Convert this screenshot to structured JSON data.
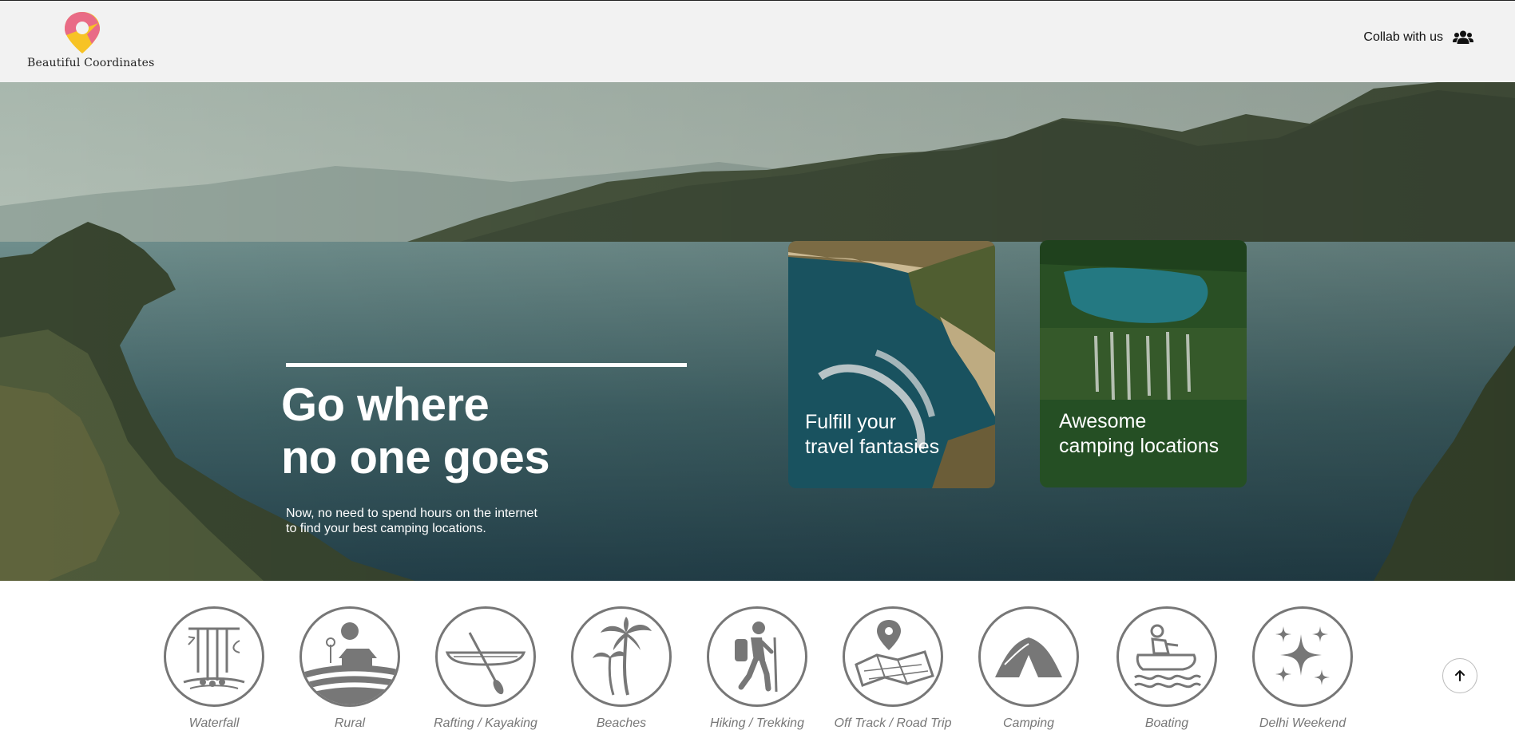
{
  "header": {
    "brand": "Beautiful Coordinates",
    "logo_colors": {
      "pin_top": "#e96b86",
      "pin_bottom": "#f7c325",
      "pin_center": "#f2f2f2"
    },
    "collab_label": "Collab with us",
    "collab_icon": "users-icon"
  },
  "hero": {
    "title_line1": "Go where",
    "title_line2": "no one goes",
    "subtitle_line1": "Now, no need to spend hours on the internet",
    "subtitle_line2": "to find your best camping locations.",
    "cards": [
      {
        "line1": "Fulfill your",
        "line2": "travel fantasies",
        "image": "coastal-beach-aerial"
      },
      {
        "line1": "Awesome",
        "line2": "camping locations",
        "image": "forest-waterfall"
      }
    ]
  },
  "categories": [
    {
      "label": "Waterfall",
      "icon": "waterfall-icon"
    },
    {
      "label": "Rural",
      "icon": "rural-farm-icon"
    },
    {
      "label": "Rafting / Kayaking",
      "icon": "kayak-icon"
    },
    {
      "label": "Beaches",
      "icon": "palm-tree-icon"
    },
    {
      "label": "Hiking / Trekking",
      "icon": "hiker-icon"
    },
    {
      "label": "Off Track / Road Trip",
      "icon": "map-pin-icon"
    },
    {
      "label": "Camping",
      "icon": "tent-icon"
    },
    {
      "label": "Boating",
      "icon": "jet-ski-icon"
    },
    {
      "label": "Delhi Weekend",
      "icon": "sparkles-icon"
    }
  ],
  "scroll_top_icon": "arrow-up-icon"
}
